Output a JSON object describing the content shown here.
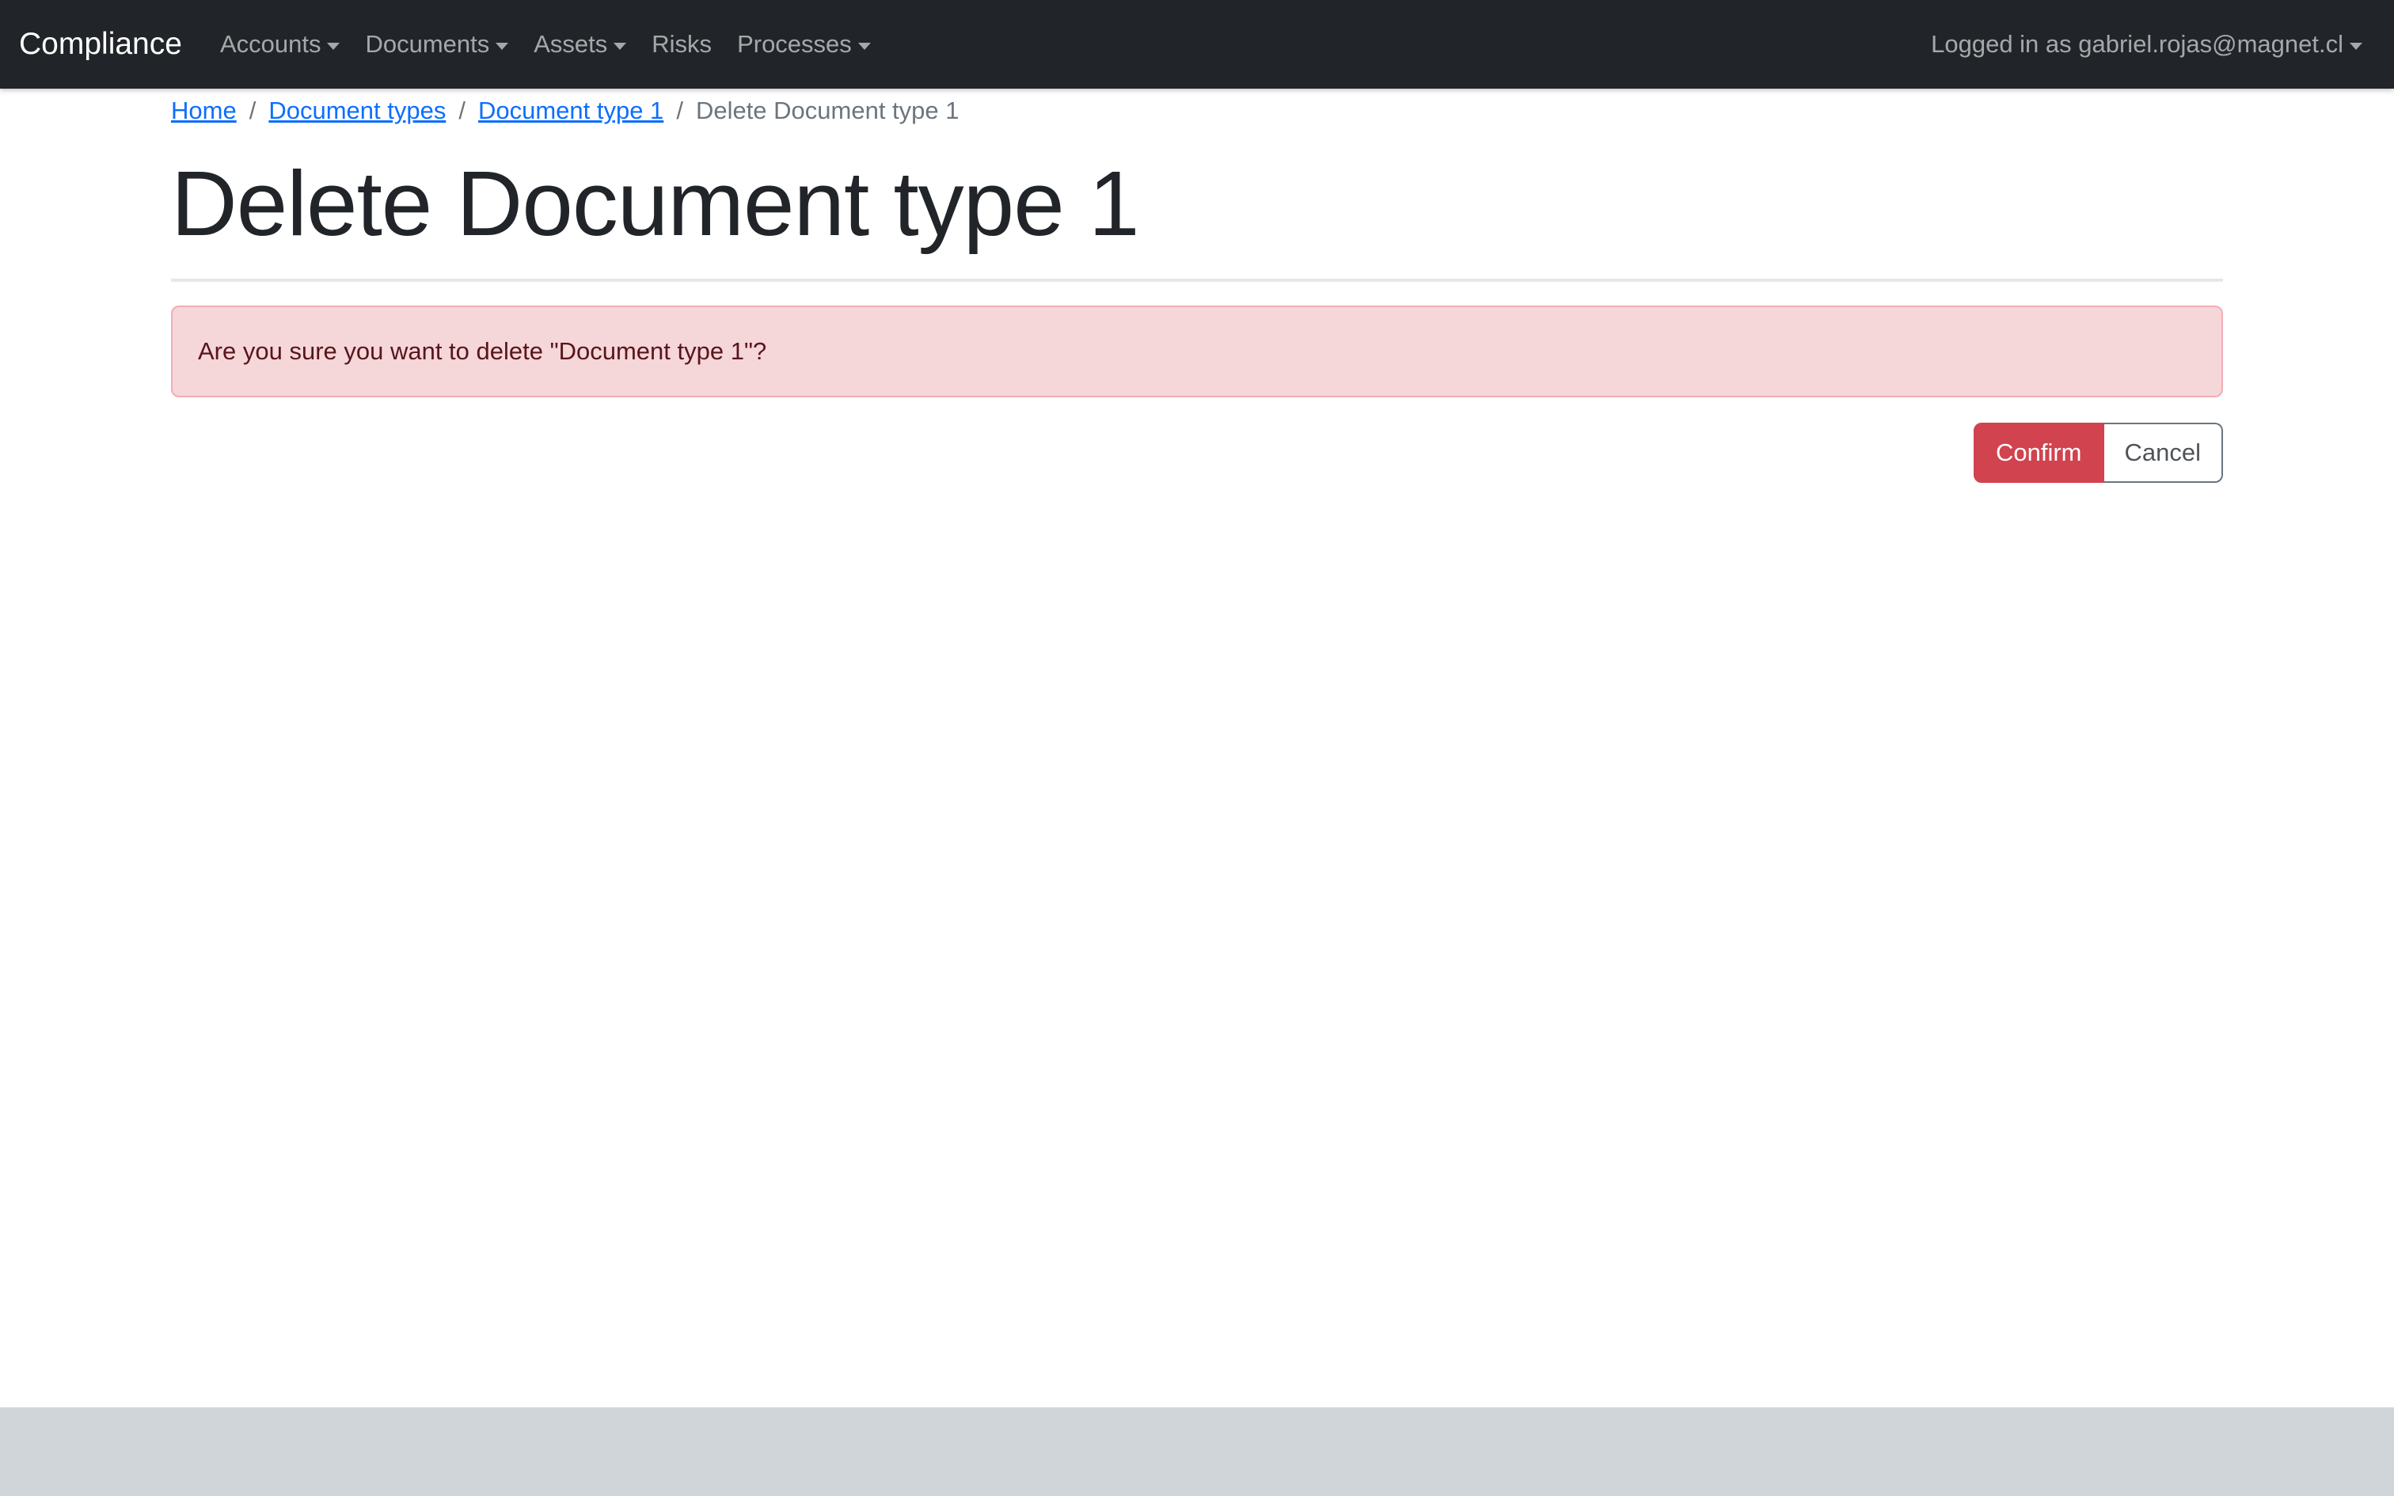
{
  "navbar": {
    "brand": "Compliance",
    "items": [
      {
        "label": "Accounts",
        "dropdown": true
      },
      {
        "label": "Documents",
        "dropdown": true
      },
      {
        "label": "Assets",
        "dropdown": true
      },
      {
        "label": "Risks",
        "dropdown": false
      },
      {
        "label": "Processes",
        "dropdown": true
      }
    ],
    "user_menu": "Logged in as gabriel.rojas@magnet.cl"
  },
  "breadcrumb": {
    "items": [
      "Home",
      "Document types",
      "Document type 1"
    ],
    "separator": "/",
    "active": "Delete Document type 1"
  },
  "page": {
    "title": "Delete Document type 1",
    "alert_message": "Are you sure you want to delete \"Document type 1\"?",
    "confirm_label": "Confirm",
    "cancel_label": "Cancel"
  },
  "colors": {
    "navbar_bg": "#212529",
    "link": "#0d6efd",
    "danger": "#d1434f",
    "alert_bg": "#f5d6d9"
  }
}
